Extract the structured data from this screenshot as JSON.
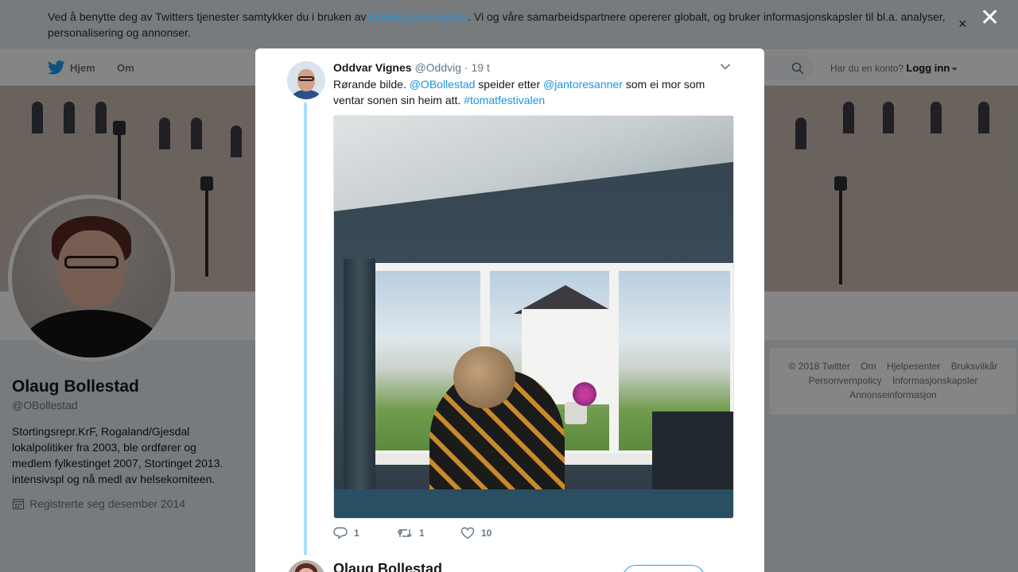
{
  "cookie_bar": {
    "text_before": "Ved å benytte deg av Twitters tjenester samtykker du i bruken av ",
    "link": "informasjonskapsler",
    "text_after": ". Vi og våre samarbeidspartnere opererer globalt, og bruker informasjonskapsler til bl.a. analyser, personalisering og annonser.",
    "close_glyph": "×"
  },
  "modal_close_glyph": "✕",
  "nav": {
    "home": "Hjem",
    "about": "Om",
    "account_prompt": "Har du en konto?",
    "login": "Logg inn"
  },
  "profile": {
    "name": "Olaug Bollestad",
    "handle": "@OBollestad",
    "bio": "Stortingsrepr.KrF, Rogaland/Gjesdal lokalpolitiker fra 2003, ble ordfører og medlem fylkestinget 2007, Stortinget 2013. intensivspl og nå medl av helsekomiteen.",
    "joined": "Registrerte seg desember 2014"
  },
  "footer": {
    "items": [
      "© 2018 Twitter",
      "Om",
      "Hjelpesenter",
      "Bruksvilkår",
      "Personvernpolicy",
      "Informasjonskapsler",
      "Annonseinformasjon"
    ]
  },
  "tweet": {
    "author_name": "Oddvar Vignes",
    "author_handle": "@Oddvig",
    "separator": "·",
    "time": "19 t",
    "text_1": "Rørande bilde. ",
    "mention_1": "@OBollestad",
    "text_2": " speider etter ",
    "mention_2": "@jantoresanner",
    "text_3": " som ei mor som ventar sonen sin heim att. ",
    "hashtag": "#tomatfestivalen",
    "replies": "1",
    "retweets": "1",
    "likes": "10"
  },
  "next_tweet": {
    "author_name": "Olaug Bollestad"
  },
  "colors": {
    "accent": "#1b95e0",
    "twitter_blue": "#1da1f2",
    "thread_line": "#a9ddfb"
  }
}
